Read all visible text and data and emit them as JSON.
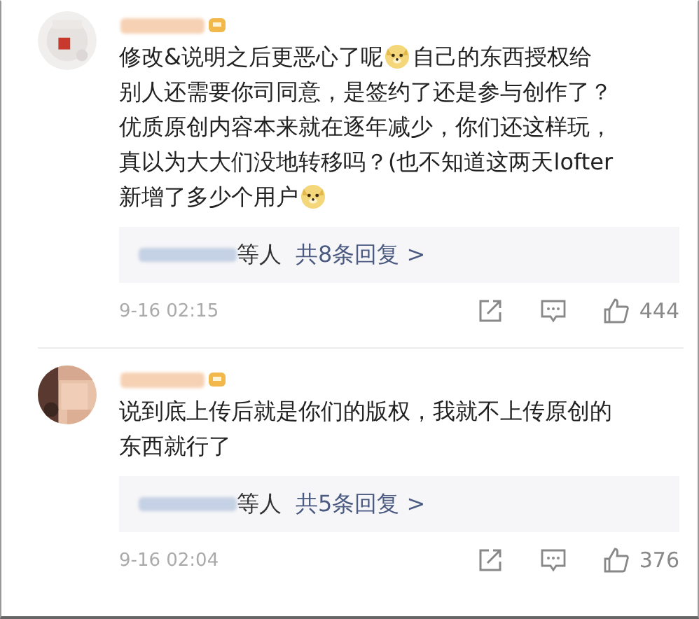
{
  "comments": [
    {
      "lines": [
        [
          {
            "kind": "text",
            "text": "修改&说明之后更恶心了呢"
          },
          {
            "kind": "emoji"
          },
          {
            "kind": "text",
            "text": "自己的东西授权给"
          }
        ],
        [
          {
            "kind": "text",
            "text": "别人还需要你司同意，是签约了还是参与创作了？"
          }
        ],
        [
          {
            "kind": "text",
            "text": "优质原创内容本来就在逐年减少，你们还这样玩，"
          }
        ],
        [
          {
            "kind": "text",
            "text": "真以为大大们没地转移吗？(也不知道这两天lofter"
          }
        ],
        [
          {
            "kind": "text",
            "text": "新增了多少个用户"
          },
          {
            "kind": "emoji"
          }
        ]
      ],
      "replies": {
        "suffix": "等人",
        "count": "共8条回复 >"
      },
      "time": "9-16 02:15",
      "likes": "444"
    },
    {
      "lines": [
        [
          {
            "kind": "text",
            "text": "说到底上传后就是你们的版权，我就不上传原创的"
          }
        ],
        [
          {
            "kind": "text",
            "text": "东西就行了"
          }
        ]
      ],
      "replies": {
        "suffix": "等人",
        "count": "共5条回复 >"
      },
      "time": "9-16 02:04",
      "likes": "376"
    }
  ]
}
